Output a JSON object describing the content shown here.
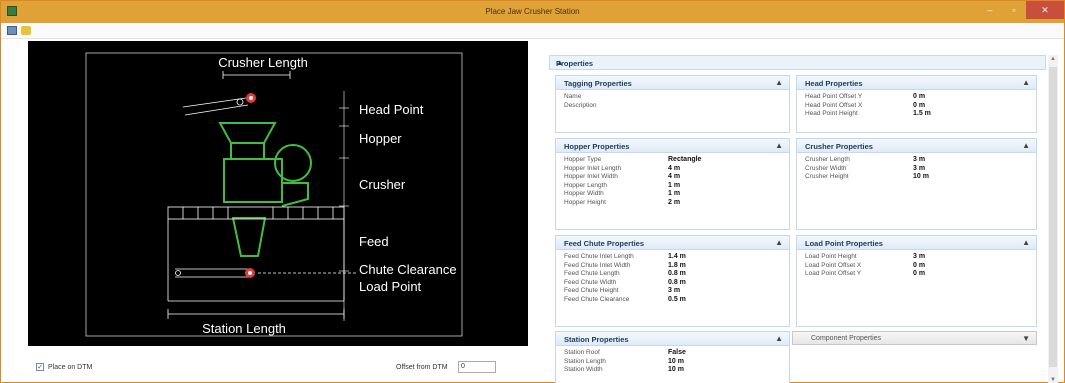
{
  "window": {
    "title": "Place Jaw Crusher Station",
    "minimize": "–",
    "maximize": "▫",
    "close": "✕"
  },
  "diagram": {
    "crusher_length": "Crusher Length",
    "head_point": "Head Point",
    "hopper": "Hopper",
    "crusher": "Crusher",
    "feed": "Feed",
    "chute_clearance": "Chute Clearance",
    "load_point": "Load Point",
    "station_length": "Station Length",
    "colors": {
      "outline": "#3fbf3f",
      "dim": "#ffffff",
      "marker": "#e53935"
    }
  },
  "bottom": {
    "place_on_dtm_checked": "✓",
    "place_on_dtm": "Place on DTM",
    "offset_label": "Offset from DTM",
    "offset_value": "0"
  },
  "properties": {
    "title": "Properties",
    "tagging": {
      "title": "Tagging Properties",
      "rows": [
        {
          "k": "Name",
          "v": ""
        },
        {
          "k": "Description",
          "v": ""
        }
      ]
    },
    "head": {
      "title": "Head Properties",
      "rows": [
        {
          "k": "Head Point Offset Y",
          "v": "0 m"
        },
        {
          "k": "Head Point Offset X",
          "v": "0 m"
        },
        {
          "k": "Head Point Height",
          "v": "1.5 m"
        }
      ]
    },
    "hopper": {
      "title": "Hopper Properties",
      "rows": [
        {
          "k": "Hopper Type",
          "v": "Rectangle"
        },
        {
          "k": "Hopper Inlet Length",
          "v": "4 m"
        },
        {
          "k": "Hopper Inlet Width",
          "v": "4 m"
        },
        {
          "k": "Hopper Length",
          "v": "1 m"
        },
        {
          "k": "Hopper Width",
          "v": "1 m"
        },
        {
          "k": "Hopper Height",
          "v": "2 m"
        }
      ]
    },
    "crusher": {
      "title": "Crusher Properties",
      "rows": [
        {
          "k": "Crusher Length",
          "v": "3 m"
        },
        {
          "k": "Crusher Width",
          "v": "3 m"
        },
        {
          "k": "Crusher Height",
          "v": "10 m"
        }
      ]
    },
    "feed_chute": {
      "title": "Feed Chute Properties",
      "rows": [
        {
          "k": "Feed Chute Inlet Length",
          "v": "1.4 m"
        },
        {
          "k": "Feed Chute Inlet Width",
          "v": "1.8 m"
        },
        {
          "k": "Feed Chute Length",
          "v": "0.8 m"
        },
        {
          "k": "Feed Chute Width",
          "v": "0.8 m"
        },
        {
          "k": "Feed Chute Height",
          "v": "3 m"
        },
        {
          "k": "Feed Chute Clearance",
          "v": "0.5 m"
        }
      ]
    },
    "load_point": {
      "title": "Load Point Properties",
      "rows": [
        {
          "k": "Load Point Height",
          "v": "3 m"
        },
        {
          "k": "Load Point Offset X",
          "v": "0 m"
        },
        {
          "k": "Load Point Offset Y",
          "v": "0 m"
        }
      ]
    },
    "station": {
      "title": "Station Properties",
      "rows": [
        {
          "k": "Station Roof",
          "v": "False"
        },
        {
          "k": "Station Length",
          "v": "10 m"
        },
        {
          "k": "Station Width",
          "v": "10 m"
        }
      ]
    },
    "component": {
      "title": "Component Properties"
    },
    "icons": {
      "collapse": "▲",
      "expand": "▼"
    }
  }
}
